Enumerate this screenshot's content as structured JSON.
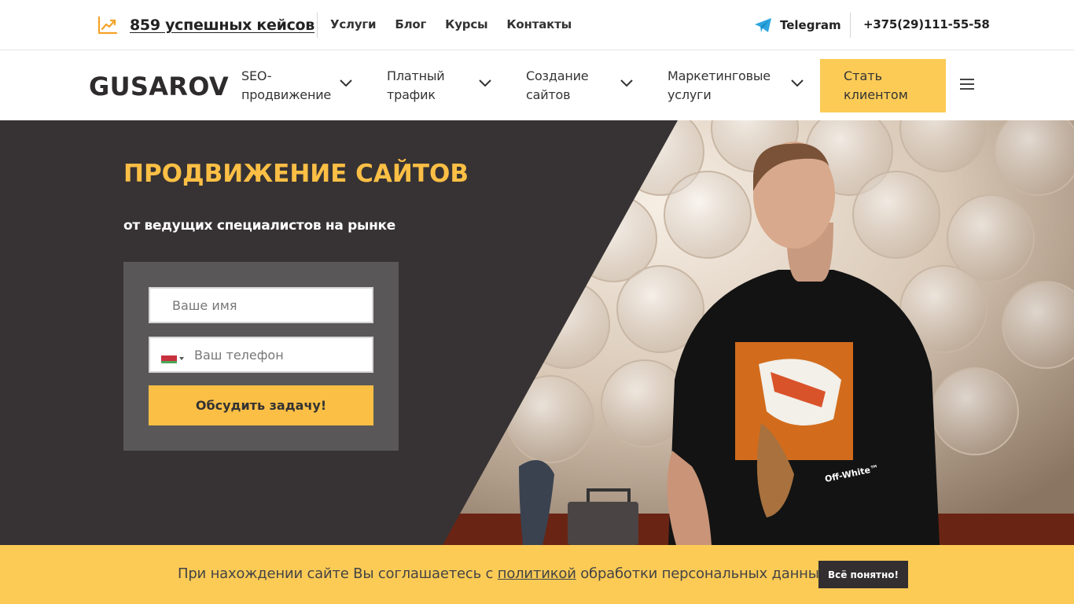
{
  "topbar": {
    "cases_label": "859 успешных кейсов",
    "links": [
      "Услуги",
      "Блог",
      "Курсы",
      "Контакты"
    ],
    "telegram_label": "Telegram",
    "phone": "+375(29)111-55-58"
  },
  "nav": {
    "logo": "GUSAROV",
    "items": [
      {
        "label": "SEO-\nпродвижение"
      },
      {
        "label": "Платный\nтрафик"
      },
      {
        "label": "Создание\nсайтов"
      },
      {
        "label": "Маркетинговые\nуслуги"
      }
    ],
    "cta_label": "Стать\nклиентом"
  },
  "hero": {
    "title": "ПРОДВИЖЕНИЕ САЙТОВ",
    "subtitle": "от ведущих специалистов на рынке",
    "form": {
      "name_placeholder": "Ваше имя",
      "phone_placeholder": "Ваш телефон",
      "submit_label": "Обсудить задачу!"
    }
  },
  "cookie": {
    "text_before": "При нахождении сайте Вы соглашаетесь с ",
    "link_text": "политикой",
    "text_after": " обработки персональных данных.",
    "button_label": "Всё понятно!"
  },
  "colors": {
    "accent": "#fccb56",
    "title_yellow": "#fcbf45",
    "dark_bg": "#373334",
    "form_bg": "#5a5758"
  },
  "icons": {
    "cases": "chart-line-icon",
    "telegram": "telegram-icon",
    "chevron": "chevron-down-icon",
    "menu": "hamburger-icon",
    "flag": "belarus-flag-icon"
  }
}
